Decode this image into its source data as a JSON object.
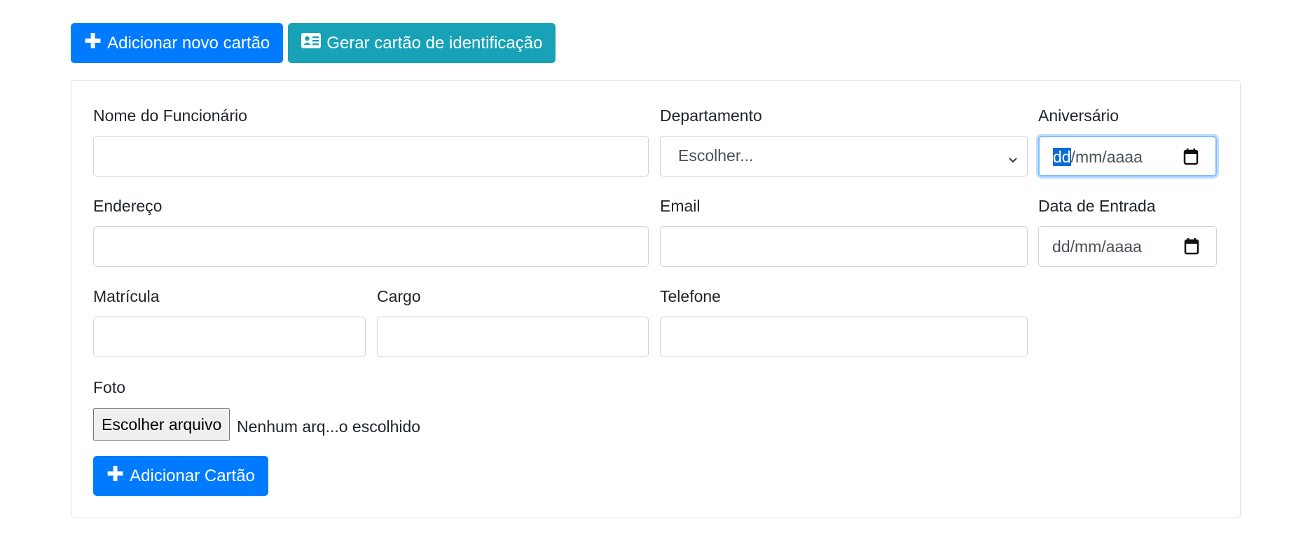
{
  "toolbar": {
    "add_card_label": "Adicionar novo cartão",
    "generate_id_label": "Gerar cartão de identificação"
  },
  "form": {
    "employee_name": {
      "label": "Nome do Funcionário",
      "value": ""
    },
    "department": {
      "label": "Departamento",
      "selected": "Escolher..."
    },
    "birthday": {
      "label": "Aniversário",
      "seg_day": "dd",
      "seg_rest": "/mm/aaaa"
    },
    "address": {
      "label": "Endereço",
      "value": ""
    },
    "email": {
      "label": "Email",
      "value": ""
    },
    "start_date": {
      "label": "Data de Entrada",
      "placeholder": "dd/mm/aaaa"
    },
    "registration": {
      "label": "Matrícula",
      "value": ""
    },
    "position": {
      "label": "Cargo",
      "value": ""
    },
    "phone": {
      "label": "Telefone",
      "value": ""
    },
    "photo": {
      "label": "Foto",
      "button": "Escolher arquivo",
      "status": "Nenhum arq...o escolhido"
    },
    "submit_label": "Adicionar Cartão"
  },
  "colors": {
    "primary": "#007bff",
    "info": "#17a2b8",
    "focus": "#80bdff",
    "selection": "#0a6ad6"
  },
  "icons": {
    "add": "plus-icon",
    "id_card": "id-card-icon",
    "dropdown": "chevron-down-icon",
    "date": "calendar-icon"
  }
}
